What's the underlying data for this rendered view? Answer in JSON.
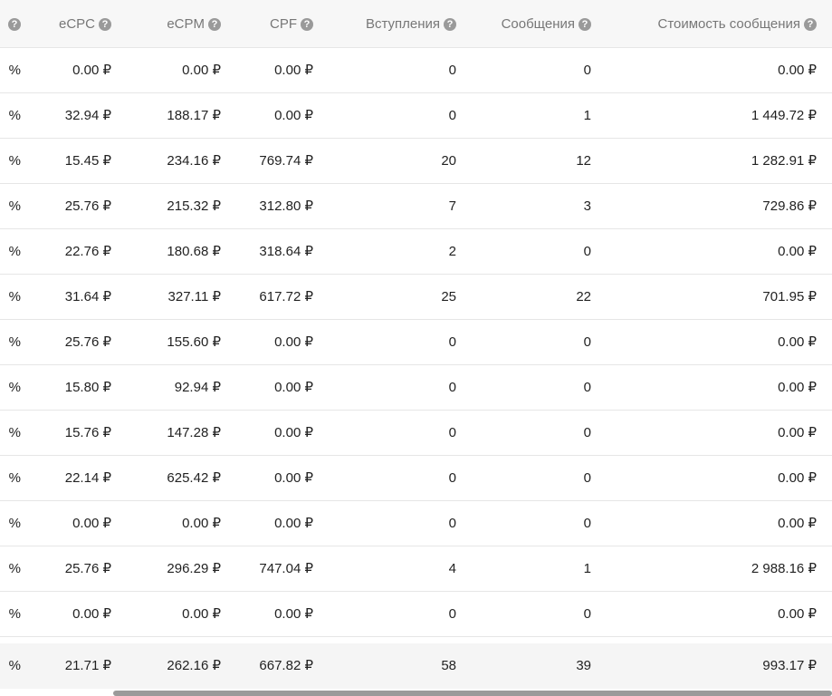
{
  "header": {
    "partial_label": "",
    "columns": [
      {
        "label": "eCPC",
        "help": "?"
      },
      {
        "label": "eCPM",
        "help": "?"
      },
      {
        "label": "CPF",
        "help": "?"
      },
      {
        "label": "Вступления",
        "help": "?"
      },
      {
        "label": "Сообщения",
        "help": "?"
      },
      {
        "label": "Стоимость сообщения",
        "help": "?"
      }
    ]
  },
  "rows": [
    {
      "pct": "%",
      "ecpc": "0.00 ₽",
      "ecpm": "0.00 ₽",
      "cpf": "0.00 ₽",
      "joins": "0",
      "messages": "0",
      "msg_cost": "0.00 ₽"
    },
    {
      "pct": "%",
      "ecpc": "32.94 ₽",
      "ecpm": "188.17 ₽",
      "cpf": "0.00 ₽",
      "joins": "0",
      "messages": "1",
      "msg_cost": "1 449.72 ₽"
    },
    {
      "pct": "%",
      "ecpc": "15.45 ₽",
      "ecpm": "234.16 ₽",
      "cpf": "769.74 ₽",
      "joins": "20",
      "messages": "12",
      "msg_cost": "1 282.91 ₽"
    },
    {
      "pct": "%",
      "ecpc": "25.76 ₽",
      "ecpm": "215.32 ₽",
      "cpf": "312.80 ₽",
      "joins": "7",
      "messages": "3",
      "msg_cost": "729.86 ₽"
    },
    {
      "pct": "%",
      "ecpc": "22.76 ₽",
      "ecpm": "180.68 ₽",
      "cpf": "318.64 ₽",
      "joins": "2",
      "messages": "0",
      "msg_cost": "0.00 ₽"
    },
    {
      "pct": "%",
      "ecpc": "31.64 ₽",
      "ecpm": "327.11 ₽",
      "cpf": "617.72 ₽",
      "joins": "25",
      "messages": "22",
      "msg_cost": "701.95 ₽"
    },
    {
      "pct": "%",
      "ecpc": "25.76 ₽",
      "ecpm": "155.60 ₽",
      "cpf": "0.00 ₽",
      "joins": "0",
      "messages": "0",
      "msg_cost": "0.00 ₽"
    },
    {
      "pct": "%",
      "ecpc": "15.80 ₽",
      "ecpm": "92.94 ₽",
      "cpf": "0.00 ₽",
      "joins": "0",
      "messages": "0",
      "msg_cost": "0.00 ₽"
    },
    {
      "pct": "%",
      "ecpc": "15.76 ₽",
      "ecpm": "147.28 ₽",
      "cpf": "0.00 ₽",
      "joins": "0",
      "messages": "0",
      "msg_cost": "0.00 ₽"
    },
    {
      "pct": "%",
      "ecpc": "22.14 ₽",
      "ecpm": "625.42 ₽",
      "cpf": "0.00 ₽",
      "joins": "0",
      "messages": "0",
      "msg_cost": "0.00 ₽"
    },
    {
      "pct": "%",
      "ecpc": "0.00 ₽",
      "ecpm": "0.00 ₽",
      "cpf": "0.00 ₽",
      "joins": "0",
      "messages": "0",
      "msg_cost": "0.00 ₽"
    },
    {
      "pct": "%",
      "ecpc": "25.76 ₽",
      "ecpm": "296.29 ₽",
      "cpf": "747.04 ₽",
      "joins": "4",
      "messages": "1",
      "msg_cost": "2 988.16 ₽"
    },
    {
      "pct": "%",
      "ecpc": "0.00 ₽",
      "ecpm": "0.00 ₽",
      "cpf": "0.00 ₽",
      "joins": "0",
      "messages": "0",
      "msg_cost": "0.00 ₽"
    }
  ],
  "total": {
    "pct": "%",
    "ecpc": "21.71 ₽",
    "ecpm": "262.16 ₽",
    "cpf": "667.82 ₽",
    "joins": "58",
    "messages": "39",
    "msg_cost": "993.17 ₽"
  },
  "colors": {
    "header_bg": "#f7f7f7",
    "row_border": "#e6e6e6",
    "total_bg": "#f5f5f5",
    "scrollbar": "#9a9a9a"
  }
}
